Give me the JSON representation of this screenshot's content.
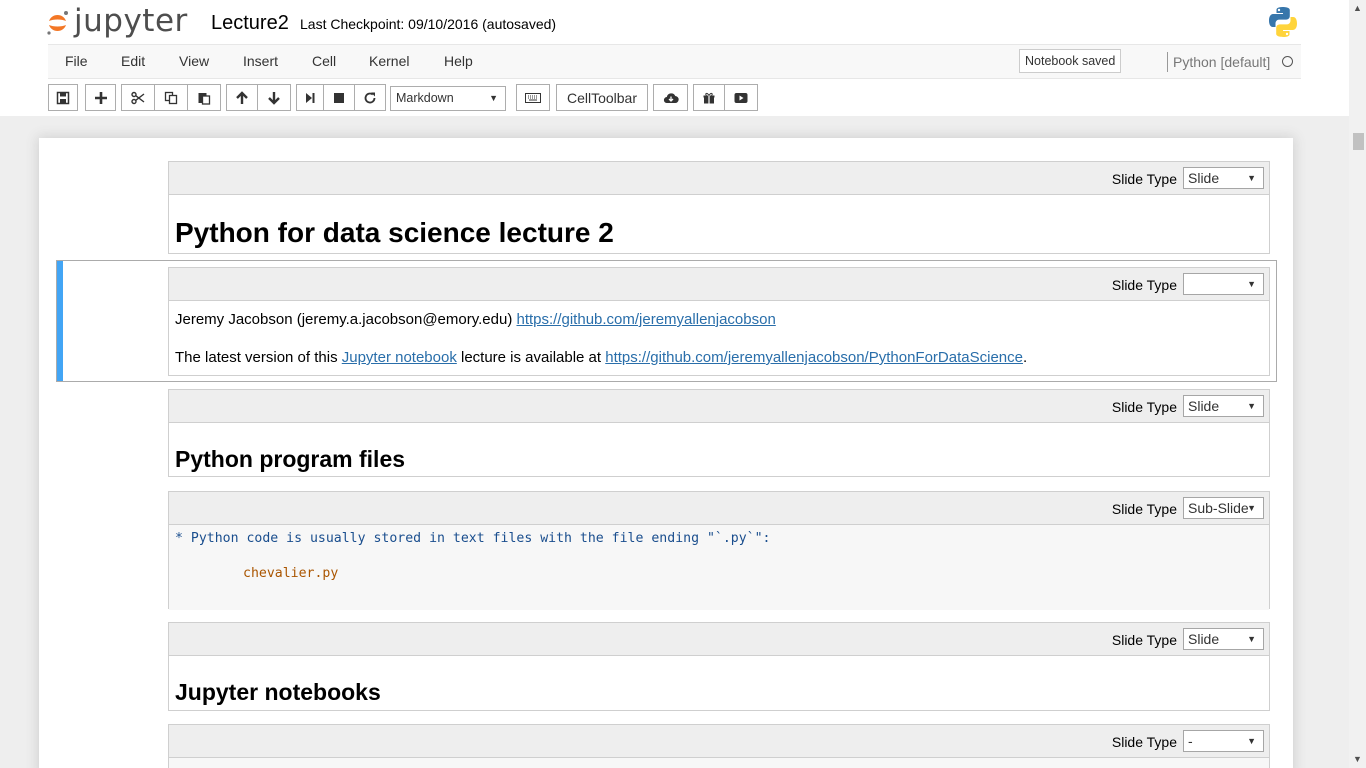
{
  "header": {
    "logo_text": "jupyter",
    "notebook_name": "Lecture2",
    "checkpoint": "Last Checkpoint: 09/10/2016 (autosaved)"
  },
  "menubar": {
    "items": [
      "File",
      "Edit",
      "View",
      "Insert",
      "Cell",
      "Kernel",
      "Help"
    ],
    "notification": "Notebook saved",
    "kernel_name": "Python [default]"
  },
  "toolbar": {
    "cell_type": "Markdown",
    "celltoolbar_label": "CellToolbar",
    "icons": [
      "save-icon",
      "plus-icon",
      "cut-icon",
      "copy-icon",
      "paste-icon",
      "arrow-up-icon",
      "arrow-down-icon",
      "step-forward-icon",
      "stop-icon",
      "refresh-icon",
      "keyboard-icon",
      "cloud-download-icon",
      "gift-icon",
      "video-icon"
    ]
  },
  "slide_type_label": "Slide Type",
  "cells": [
    {
      "slide_type": "Slide",
      "heading": "Python for data science lecture 2"
    },
    {
      "slide_type": "",
      "line1_text": "Jeremy Jacobson (jeremy.a.jacobson@emory.edu) ",
      "line1_link": "https://github.com/jeremyallenjacobson",
      "line2_pre": "The latest version of this ",
      "line2_link1": "Jupyter notebook",
      "line2_mid": " lecture is available at ",
      "line2_link2": "https://github.com/jeremyallenjacobson/PythonForDataScience",
      "line2_end": "."
    },
    {
      "slide_type": "Slide",
      "heading": "Python program files"
    },
    {
      "slide_type": "Sub-Slide",
      "code_line": "* Python code is usually stored in text files with the file ending \"`.py`\":",
      "code_file": "chevalier.py"
    },
    {
      "slide_type": "Slide",
      "heading": "Jupyter notebooks"
    },
    {
      "slide_type": "-"
    }
  ],
  "colors": {
    "selected_bar": "#42a5f5",
    "link": "#296eaa",
    "jupyter_orange": "#f37726"
  }
}
